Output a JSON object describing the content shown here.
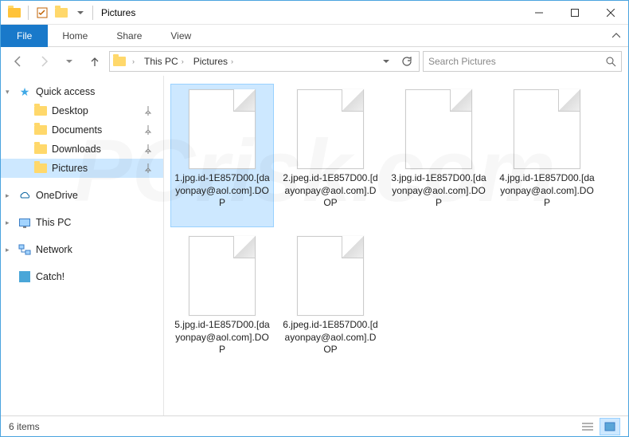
{
  "titlebar": {
    "title": "Pictures"
  },
  "ribbon": {
    "file": "File",
    "tabs": [
      "Home",
      "Share",
      "View"
    ]
  },
  "breadcrumb": {
    "root": "This PC",
    "current": "Pictures"
  },
  "search": {
    "placeholder": "Search Pictures"
  },
  "sidebar": {
    "quick_access": {
      "label": "Quick access",
      "expanded": true
    },
    "quick_items": [
      {
        "label": "Desktop",
        "pinned": true
      },
      {
        "label": "Documents",
        "pinned": true
      },
      {
        "label": "Downloads",
        "pinned": true
      },
      {
        "label": "Pictures",
        "pinned": true,
        "selected": true
      }
    ],
    "onedrive": "OneDrive",
    "thispc": "This PC",
    "network": "Network",
    "catch": "Catch!"
  },
  "files": [
    {
      "name": "1.jpg.id-1E857D00.[dayonpay@aol.com].DOP",
      "selected": true
    },
    {
      "name": "2.jpeg.id-1E857D00.[dayonpay@aol.com].DOP"
    },
    {
      "name": "3.jpg.id-1E857D00.[dayonpay@aol.com].DOP"
    },
    {
      "name": "4.jpg.id-1E857D00.[dayonpay@aol.com].DOP"
    },
    {
      "name": "5.jpg.id-1E857D00.[dayonpay@aol.com].DOP"
    },
    {
      "name": "6.jpeg.id-1E857D00.[dayonpay@aol.com].DOP"
    }
  ],
  "status": {
    "count_text": "6 items"
  }
}
